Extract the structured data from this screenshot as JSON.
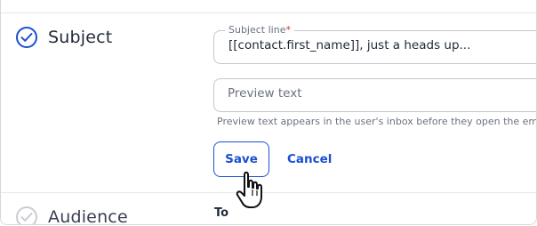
{
  "subject_section": {
    "title": "Subject",
    "subject_field": {
      "label": "Subject line",
      "required_mark": "*",
      "value": "[[contact.first_name]], just a heads up..."
    },
    "preview_field": {
      "placeholder": "Preview text",
      "value": "",
      "helper": "Preview text appears in the user's inbox before they open the em"
    },
    "save_label": "Save",
    "cancel_label": "Cancel",
    "icon": "check-circle-icon"
  },
  "audience_section": {
    "title": "Audience",
    "to_label": "To",
    "icon": "check-circle-icon"
  },
  "colors": {
    "accent": "#1a4fd0",
    "required": "#d9382c",
    "muted_border": "#c9ccd1"
  }
}
